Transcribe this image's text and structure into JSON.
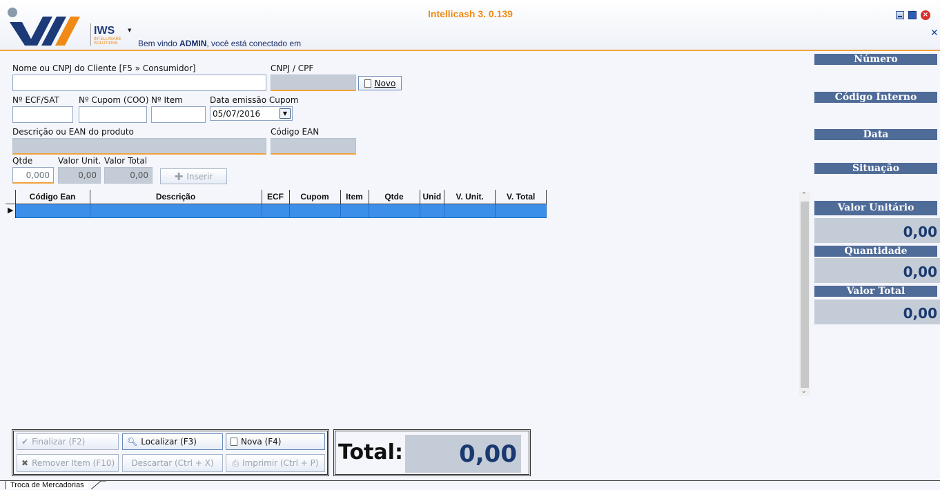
{
  "header": {
    "title": "Intellicash 3. 0.139",
    "logo_text": "IWS",
    "logo_sub": "INTELLIWARE SOLUTIONS",
    "welcome_prefix": "Bem vindo ",
    "welcome_user": "ADMIN",
    "welcome_suffix": ", você está conectado em",
    "menu_arrow": "▼"
  },
  "window_controls": {
    "minimize": "minimize-icon",
    "maximize": "maximize-icon",
    "close": "close-icon",
    "close_tab": "✕"
  },
  "form": {
    "client_label": "Nome ou CNPJ do Cliente [F5 » Consumidor]",
    "client_value": "",
    "cnpj_label": "CNPJ / CPF",
    "cnpj_value": "",
    "novo_button": "Novo",
    "ecf_label": "Nº ECF/SAT",
    "cupom_label": "Nº Cupom (COO)",
    "item_label": "Nº Item",
    "data_label": "Data emissão Cupom",
    "data_value": "05/07/2016",
    "descricao_label": "Descrição ou EAN do produto",
    "ean_label": "Código EAN",
    "qtde_label": "Qtde",
    "valor_unit_label": "Valor Unit.",
    "valor_total_label": "Valor Total",
    "qtde_value": "0,000",
    "valor_unit_value": "0,00",
    "valor_total_value": "0,00",
    "inserir_button": "Inserir"
  },
  "grid": {
    "columns": [
      "Código Ean",
      "Descrição",
      "ECF",
      "Cupom",
      "Item",
      "Qtde",
      "Unid",
      "V. Unit.",
      "V. Total"
    ],
    "rows": [
      [
        "",
        "",
        "",
        "",
        "",
        "",
        "",
        "",
        ""
      ]
    ]
  },
  "side": {
    "numero_label": "Número",
    "codigo_interno_label": "Código Interno",
    "data_label": "Data",
    "situacao_label": "Situação",
    "valor_unitario_label": "Valor Unitário",
    "valor_unitario_value": "0,00",
    "quantidade_label": "Quantidade",
    "quantidade_value": "0,00",
    "valor_total_label": "Valor Total",
    "valor_total_value": "0,00"
  },
  "actions": {
    "finalizar": "Finalizar (F2)",
    "localizar": "Localizar (F3)",
    "nova": "Nova (F4)",
    "remover": "Remover Item (F10)",
    "descartar": "Descartar (Ctrl + X)",
    "imprimir": "Imprimir (Ctrl + P)"
  },
  "total": {
    "label": "Total:",
    "value": "0,00"
  },
  "tabs": [
    "Troca de Mercadorias"
  ],
  "colors": {
    "accent": "#ef8a17",
    "header_blue": "#4f6b98",
    "selection": "#3c8fe8",
    "value_text": "#1a3970"
  }
}
